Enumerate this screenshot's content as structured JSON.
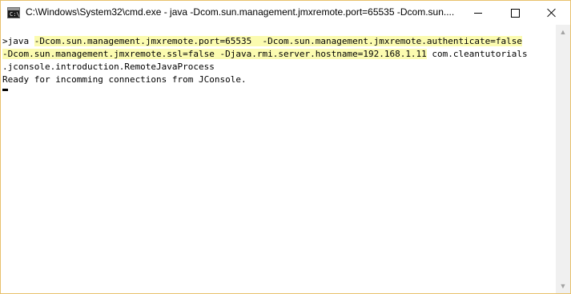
{
  "window": {
    "title": "C:\\Windows\\System32\\cmd.exe - java  -Dcom.sun.management.jmxremote.port=65535  -Dcom.sun....",
    "app_icon_glyph": "C:\\.",
    "border_color": "#e8c16c"
  },
  "controls": {
    "minimize_icon": "minimize-icon",
    "maximize_icon": "maximize-icon",
    "close_icon": "close-icon"
  },
  "console": {
    "line1": {
      "prompt": ">java ",
      "highlight": "-Dcom.sun.management.jmxremote.port=65535  -Dcom.sun.management.jmxremote.authenticate=false"
    },
    "line2": {
      "highlight": "-Dcom.sun.management.jmxremote.ssl=false -Djava.rmi.server.hostname=192.168.1.11",
      "rest": " com.cleantutorials"
    },
    "line3": ".jconsole.introduction.RemoteJavaProcess",
    "line4": "Ready for incomming connections from JConsole.",
    "highlight_color": "#fbfbb0"
  },
  "scrollbar": {
    "up_arrow": "▲",
    "down_arrow": "▼"
  }
}
